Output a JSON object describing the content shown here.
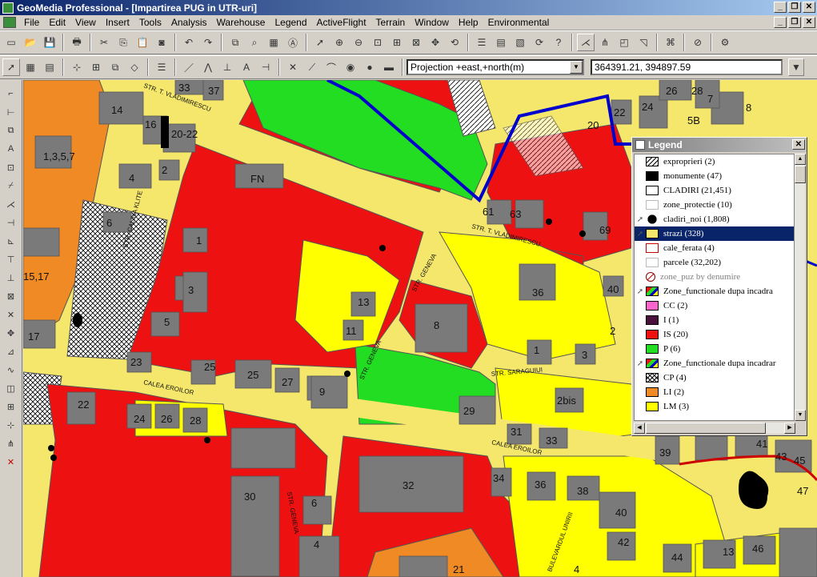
{
  "window": {
    "title": "GeoMedia Professional - [Impartirea PUG in UTR-uri]"
  },
  "menu": [
    "File",
    "Edit",
    "View",
    "Insert",
    "Tools",
    "Analysis",
    "Warehouse",
    "Legend",
    "ActiveFlight",
    "Terrain",
    "Window",
    "Help",
    "Environmental"
  ],
  "toolbar2": {
    "projection": "Projection +east,+north(m)",
    "coordinates": "364391.21, 394897.59"
  },
  "legend": {
    "title": "Legend",
    "items": [
      {
        "label": "exproprieri  (2)",
        "swatch": "hatch",
        "color": "#ffffff"
      },
      {
        "label": "monumente  (47)",
        "swatch": "fill",
        "color": "#000000"
      },
      {
        "label": "CLADIRI  (21,451)",
        "swatch": "outline",
        "color": "#ffffff"
      },
      {
        "label": "zone_protectie  (10)",
        "swatch": "outline-light",
        "color": "#ffffff"
      },
      {
        "label": "cladiri_noi  (1,808)",
        "swatch": "dot",
        "color": "#000000"
      },
      {
        "label": "strazi  (328)",
        "swatch": "fill",
        "color": "#f5e76b",
        "selected": true
      },
      {
        "label": "cale_ferata  (4)",
        "swatch": "red-outline",
        "color": "#ffffff"
      },
      {
        "label": "parcele  (32,202)",
        "swatch": "outline-light",
        "color": "#ffffff"
      },
      {
        "label": "zone_puz by denumire",
        "swatch": "nosym",
        "color": "#ffffff",
        "dim": true
      },
      {
        "label": "Zone_functionale dupa  incadra",
        "swatch": "theme",
        "color": "#ffffff"
      },
      {
        "label": "CC  (2)",
        "swatch": "fill",
        "color": "#ff66cc",
        "indent": true
      },
      {
        "label": "I  (1)",
        "swatch": "fill",
        "color": "#4b0f3c",
        "indent": true
      },
      {
        "label": "IS  (20)",
        "swatch": "fill",
        "color": "#ee1111",
        "indent": true
      },
      {
        "label": "P  (6)",
        "swatch": "fill",
        "color": "#22dd22",
        "indent": true
      },
      {
        "label": "Zone_functionale dupa incadrar",
        "swatch": "theme",
        "color": "#ffffff"
      },
      {
        "label": "CP  (4)",
        "swatch": "crosshatch",
        "color": "#ffffff",
        "indent": true
      },
      {
        "label": "LI  (2)",
        "swatch": "fill",
        "color": "#f08a24",
        "indent": true
      },
      {
        "label": "LM  (3)",
        "swatch": "fill",
        "color": "#ffff00",
        "indent": true
      }
    ]
  },
  "map": {
    "building_numbers": [
      "33",
      "37",
      "14",
      "16",
      "20-22",
      "1,3,5,7",
      "4",
      "2",
      "FN",
      "6",
      "1",
      "15,17",
      "3",
      "5",
      "17",
      "23",
      "25",
      "25",
      "27",
      "13",
      "11",
      "9",
      "8",
      "36",
      "40",
      "1",
      "3",
      "2",
      "61",
      "63",
      "69",
      "22",
      "20",
      "24",
      "26",
      "28",
      "5B",
      "8",
      "7",
      "29",
      "2bis",
      "31",
      "33",
      "37",
      "39",
      "41",
      "43",
      "45",
      "47",
      "22",
      "24",
      "26",
      "28",
      "32",
      "34",
      "36",
      "38",
      "40",
      "42",
      "44",
      "46",
      "13",
      "30",
      "6",
      "4",
      "4",
      "21"
    ],
    "street_names": [
      "STR. T. VLADIMIRESCU",
      "STR. T. VLADIMIRESCU",
      "STR. GENEVA",
      "STR. GENEVA",
      "CALEA EROILOR",
      "CALEA EROILOR",
      "STR. SARAGUIUI",
      "STR. GENEVA",
      "STR. CALINA KLITE",
      "BULEVARDUL UNIRII"
    ]
  },
  "colors": {
    "street": "#f5e76b",
    "is_zone": "#ee1111",
    "lm_zone": "#ffff00",
    "li_zone": "#f08a24",
    "p_zone": "#22dd22",
    "building": "#7a7a7a",
    "boundary": "#0000cc"
  }
}
